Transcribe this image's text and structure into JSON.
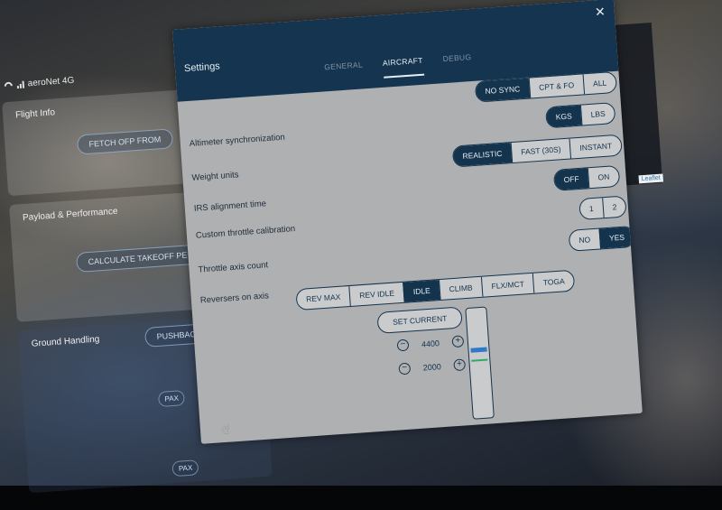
{
  "status_bar": {
    "network": "aeroNet 4G"
  },
  "background": {
    "flight_info": {
      "title": "Flight Info",
      "button": "FETCH OFP FROM"
    },
    "payload": {
      "title": "Payload & Performance",
      "button": "CALCULATE TAKEOFF PE"
    },
    "ground": {
      "title": "Ground Handling",
      "pushback": "PUSHBACK",
      "pax": "PAX"
    },
    "map": {
      "zoom_in": "+",
      "zoom_out": "−",
      "attribution": "Leaflet"
    }
  },
  "dialog": {
    "title": "Settings",
    "close": "✕",
    "tabs": [
      {
        "label": "GENERAL",
        "active": false
      },
      {
        "label": "AIRCRAFT",
        "active": true
      },
      {
        "label": "DEBUG",
        "active": false
      }
    ],
    "rows": {
      "altimeter": {
        "label": "Altimeter synchronization",
        "options": [
          "NO SYNC",
          "CPT & FO",
          "ALL"
        ],
        "selected": "NO SYNC"
      },
      "weight": {
        "label": "Weight units",
        "options": [
          "KGS",
          "LBS"
        ],
        "selected": "KGS"
      },
      "irs": {
        "label": "IRS alignment time",
        "options": [
          "REALISTIC",
          "FAST (30S)",
          "INSTANT"
        ],
        "selected": "REALISTIC"
      },
      "throttle_cal": {
        "label": "Custom throttle calibration",
        "options": [
          "OFF",
          "ON"
        ],
        "selected": "OFF"
      },
      "axis_count": {
        "label": "Throttle axis count",
        "options": [
          "1",
          "2"
        ],
        "selected": ""
      },
      "reversers": {
        "label": "Reversers on axis",
        "options": [
          "NO",
          "YES"
        ],
        "selected": "YES"
      }
    },
    "detents": {
      "options": [
        "REV MAX",
        "REV IDLE",
        "IDLE",
        "CLIMB",
        "FLX/MCT",
        "TOGA"
      ],
      "selected": "IDLE"
    },
    "set_current": "SET CURRENT",
    "stepper_upper": {
      "minus": "−",
      "value": "4400",
      "plus": "+"
    },
    "stepper_lower": {
      "minus": "−",
      "value": "2000",
      "plus": "+"
    },
    "colors": {
      "header": "#15344f",
      "accent": "#14334d",
      "axis_blue": "#2f79c9",
      "axis_green": "#2fa86a"
    },
    "axis_indicator": {
      "blue_level": 0.64,
      "green_level": 0.53
    }
  }
}
